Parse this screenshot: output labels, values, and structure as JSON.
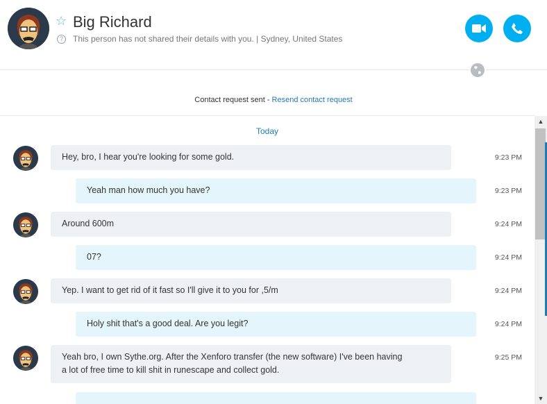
{
  "contact": {
    "name": "Big Richard",
    "subtitle": "This person has not shared their details with you.  |  Sydney, United States"
  },
  "contact_request": {
    "text": "Contact request sent - ",
    "link": "Resend contact request"
  },
  "chat": {
    "day_label": "Today",
    "messages": [
      {
        "dir": "in",
        "text": "Hey, bro, I hear you're looking for some gold.",
        "time": "9:23 PM"
      },
      {
        "dir": "out",
        "text": "Yeah man how much you have?",
        "time": "9:23 PM"
      },
      {
        "dir": "in",
        "text": "Around 600m",
        "time": "9:24 PM"
      },
      {
        "dir": "out",
        "text": "07?",
        "time": "9:24 PM"
      },
      {
        "dir": "in",
        "text": "Yep. I want to get rid of it fast so I'll give it to you for ,5/m",
        "time": "9:24 PM"
      },
      {
        "dir": "out",
        "text": "Holy shit that's a good deal. Are you legit?",
        "time": "9:24 PM"
      },
      {
        "dir": "in",
        "text": "Yeah bro, I own Sythe.org. After the Xenforo transfer (the new software) I've been having\na lot of free time to kill shit in runescape and collect gold.",
        "time": "9:25 PM"
      },
      {
        "dir": "out",
        "text": "",
        "time": ""
      }
    ]
  },
  "icons": {
    "star": "star-outline-icon",
    "info": "info-icon",
    "video": "video-call-icon",
    "audio": "phone-call-icon",
    "globe": "globe-icon"
  },
  "colors": {
    "accent": "#00aff0",
    "link": "#1f7ab8",
    "incoming_bubble": "#eef1f4",
    "outgoing_bubble": "#e5f5fc"
  }
}
